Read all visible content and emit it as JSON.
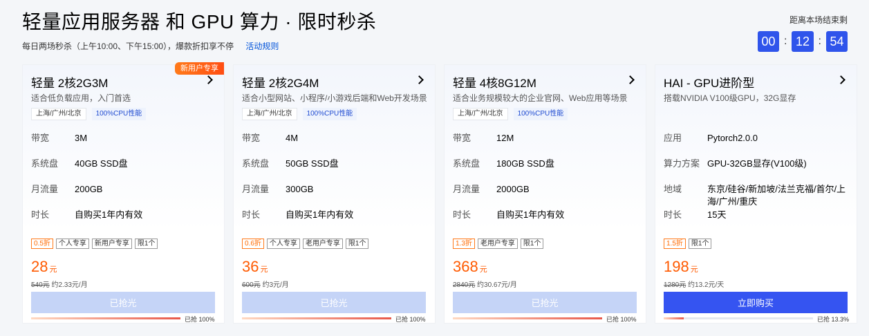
{
  "header": {
    "title": "轻量应用服务器 和 GPU 算力 · 限时秒杀",
    "subtitle": "每日两场秒杀（上午10:00、下午15:00），爆款折扣享不停",
    "rule_link": "活动规则"
  },
  "countdown": {
    "label": "距离本场结束剩",
    "hours": "00",
    "minutes": "12",
    "seconds": "54",
    "separator": ":",
    "color": "#2f54eb"
  },
  "cards": [
    {
      "corner_tag": "新用户专享",
      "name": "轻量 2核2G3M",
      "desc": "适合低负载应用，入门首选",
      "badges": [
        "上海/广州/北京",
        "100%CPU性能"
      ],
      "specs": [
        {
          "key": "带宽",
          "val": "3M"
        },
        {
          "key": "系统盘",
          "val": "40GB SSD盘"
        },
        {
          "key": "月流量",
          "val": "200GB"
        },
        {
          "key": "时长",
          "val": "自购买1年内有效"
        }
      ],
      "tags": [
        "0.5折",
        "个人专享",
        "新用户专享",
        "限1个"
      ],
      "price": "28",
      "unit": "元",
      "orig": "540元",
      "per": "约2.33元/月",
      "button": "已抢光",
      "sold_out": true,
      "progress_label": "已抢 100%",
      "progress": 100
    },
    {
      "corner_tag": "",
      "name": "轻量 2核2G4M",
      "desc": "适合小型网站、小程序/小游戏后端和Web开发场景",
      "badges": [
        "上海/广州/北京",
        "100%CPU性能"
      ],
      "specs": [
        {
          "key": "带宽",
          "val": "4M"
        },
        {
          "key": "系统盘",
          "val": "50GB SSD盘"
        },
        {
          "key": "月流量",
          "val": "300GB"
        },
        {
          "key": "时长",
          "val": "自购买1年内有效"
        }
      ],
      "tags": [
        "0.6折",
        "个人专享",
        "老用户专享",
        "限1个"
      ],
      "price": "36",
      "unit": "元",
      "orig": "600元",
      "per": "约3元/月",
      "button": "已抢光",
      "sold_out": true,
      "progress_label": "已抢 100%",
      "progress": 100
    },
    {
      "corner_tag": "",
      "name": "轻量 4核8G12M",
      "desc": "适合业务规模较大的企业官网、Web应用等场景",
      "badges": [
        "上海/广州/北京",
        "100%CPU性能"
      ],
      "specs": [
        {
          "key": "带宽",
          "val": "12M"
        },
        {
          "key": "系统盘",
          "val": "180GB SSD盘"
        },
        {
          "key": "月流量",
          "val": "2000GB"
        },
        {
          "key": "时长",
          "val": "自购买1年内有效"
        }
      ],
      "tags": [
        "1.3折",
        "老用户专享",
        "限1个"
      ],
      "price": "368",
      "unit": "元",
      "orig": "2840元",
      "per": "约30.67元/月",
      "button": "已抢光",
      "sold_out": true,
      "progress_label": "已抢 100%",
      "progress": 100
    },
    {
      "corner_tag": "",
      "name": "HAI - GPU进阶型",
      "desc": "搭载NVIDIA V100级GPU，32G显存",
      "badges": [],
      "specs": [
        {
          "key": "应用",
          "val": "Pytorch2.0.0"
        },
        {
          "key": "算力方案",
          "val": "GPU-32GB显存(V100级)"
        },
        {
          "key": "地域",
          "val": "东京/硅谷/新加坡/法兰克福/首尔/上海/广州/重庆"
        },
        {
          "key": "时长",
          "val": "15天"
        }
      ],
      "tags": [
        "1.5折",
        "限1个"
      ],
      "price": "198",
      "unit": "元",
      "orig": "1280元",
      "per": "约13.2元/天",
      "button": "立即购买",
      "sold_out": false,
      "progress_label": "已抢 13.3%",
      "progress": 13.3
    }
  ]
}
